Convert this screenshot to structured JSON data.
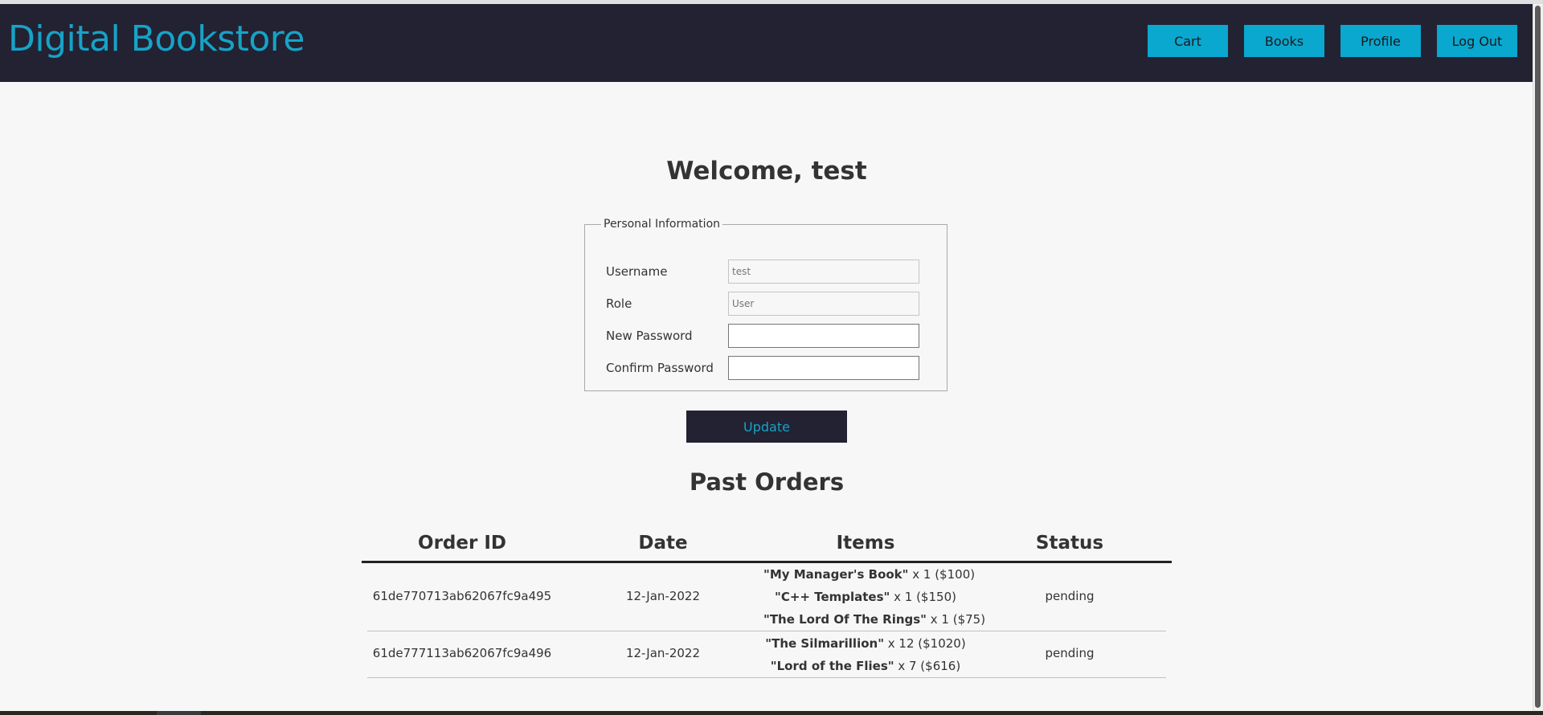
{
  "header": {
    "brand": "Digital Bookstore",
    "nav": {
      "cart": "Cart",
      "books": "Books",
      "profile": "Profile",
      "logout": "Log Out"
    }
  },
  "welcome": "Welcome, test",
  "personal_info": {
    "legend": "Personal Information",
    "username_label": "Username",
    "username_placeholder": "test",
    "role_label": "Role",
    "role_placeholder": "User",
    "new_password_label": "New Password",
    "new_password_value": "",
    "confirm_password_label": "Confirm Password",
    "confirm_password_value": ""
  },
  "update_button": "Update",
  "orders": {
    "title": "Past Orders",
    "columns": {
      "order_id": "Order ID",
      "date": "Date",
      "items": "Items",
      "status": "Status"
    },
    "rows": [
      {
        "order_id": "61de770713ab62067fc9a495",
        "date": "12-Jan-2022",
        "items": [
          {
            "title": "\"My Manager's Book\"",
            "detail": " x 1 ($100)"
          },
          {
            "title": "\"C++ Templates\"",
            "detail": " x 1 ($150)"
          },
          {
            "title": "\"The Lord Of The Rings\"",
            "detail": " x 1 ($75)"
          }
        ],
        "status": "pending"
      },
      {
        "order_id": "61de777113ab62067fc9a496",
        "date": "12-Jan-2022",
        "items": [
          {
            "title": "\"The Silmarillion\"",
            "detail": " x 12 ($1020)"
          },
          {
            "title": "\"Lord of the Flies\"",
            "detail": " x 7 ($616)"
          }
        ],
        "status": "pending"
      }
    ]
  }
}
